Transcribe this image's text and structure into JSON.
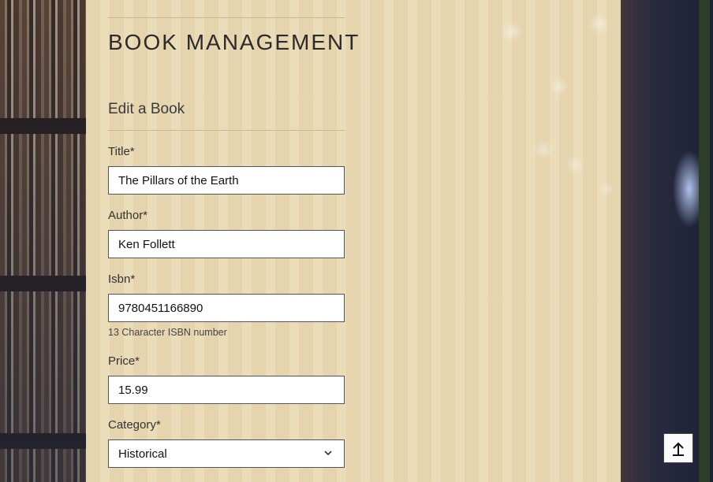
{
  "page": {
    "heading": "BOOK MANAGEMENT",
    "subheading": "Edit a Book"
  },
  "form": {
    "title_label": "Title*",
    "title_value": "The Pillars of the Earth",
    "author_label": "Author*",
    "author_value": "Ken Follett",
    "isbn_label": "Isbn*",
    "isbn_value": "9780451166890",
    "isbn_hint": "13 Character ISBN number",
    "price_label": "Price*",
    "price_value": "15.99",
    "category_label": "Category*",
    "category_value": "Historical"
  },
  "icons": {
    "chevron": "chevron-down-icon",
    "back_to_top": "arrow-up-icon"
  }
}
